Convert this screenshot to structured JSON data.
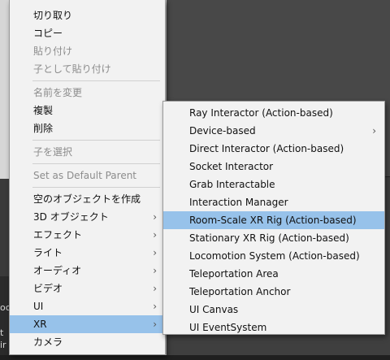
{
  "background": {
    "snippets": [
      "oc",
      "t",
      "ir"
    ]
  },
  "context_menu": {
    "groups": [
      [
        {
          "label": "切り取り",
          "enabled": true
        },
        {
          "label": "コピー",
          "enabled": true
        },
        {
          "label": "貼り付け",
          "enabled": false
        },
        {
          "label": "子として貼り付け",
          "enabled": false
        }
      ],
      [
        {
          "label": "名前を変更",
          "enabled": false
        },
        {
          "label": "複製",
          "enabled": true
        },
        {
          "label": "削除",
          "enabled": true
        }
      ],
      [
        {
          "label": "子を選択",
          "enabled": false
        }
      ],
      [
        {
          "label": "Set as Default Parent",
          "enabled": false
        }
      ],
      [
        {
          "label": "空のオブジェクトを作成",
          "enabled": true
        },
        {
          "label": "3D オブジェクト",
          "enabled": true,
          "submenu": true
        },
        {
          "label": "エフェクト",
          "enabled": true,
          "submenu": true
        },
        {
          "label": "ライト",
          "enabled": true,
          "submenu": true
        },
        {
          "label": "オーディオ",
          "enabled": true,
          "submenu": true
        },
        {
          "label": "ビデオ",
          "enabled": true,
          "submenu": true
        },
        {
          "label": "UI",
          "enabled": true,
          "submenu": true
        },
        {
          "label": "XR",
          "enabled": true,
          "submenu": true,
          "selected": true
        },
        {
          "label": "カメラ",
          "enabled": true
        }
      ]
    ]
  },
  "xr_submenu": {
    "items": [
      {
        "label": "Ray Interactor (Action-based)"
      },
      {
        "label": "Device-based",
        "submenu": true
      },
      {
        "label": "Direct Interactor (Action-based)"
      },
      {
        "label": "Socket Interactor"
      },
      {
        "label": "Grab Interactable"
      },
      {
        "label": "Interaction Manager"
      },
      {
        "label": "Room-Scale XR Rig (Action-based)",
        "selected": true
      },
      {
        "label": "Stationary XR Rig (Action-based)"
      },
      {
        "label": "Locomotion System (Action-based)"
      },
      {
        "label": "Teleportation Area"
      },
      {
        "label": "Teleportation Anchor"
      },
      {
        "label": "UI Canvas"
      },
      {
        "label": "UI EventSystem"
      }
    ]
  },
  "arrow_glyph": "›",
  "colors": {
    "menu_bg": "#f2f2f2",
    "highlight": "#97c2ea",
    "disabled_text": "#8c8c8c"
  }
}
